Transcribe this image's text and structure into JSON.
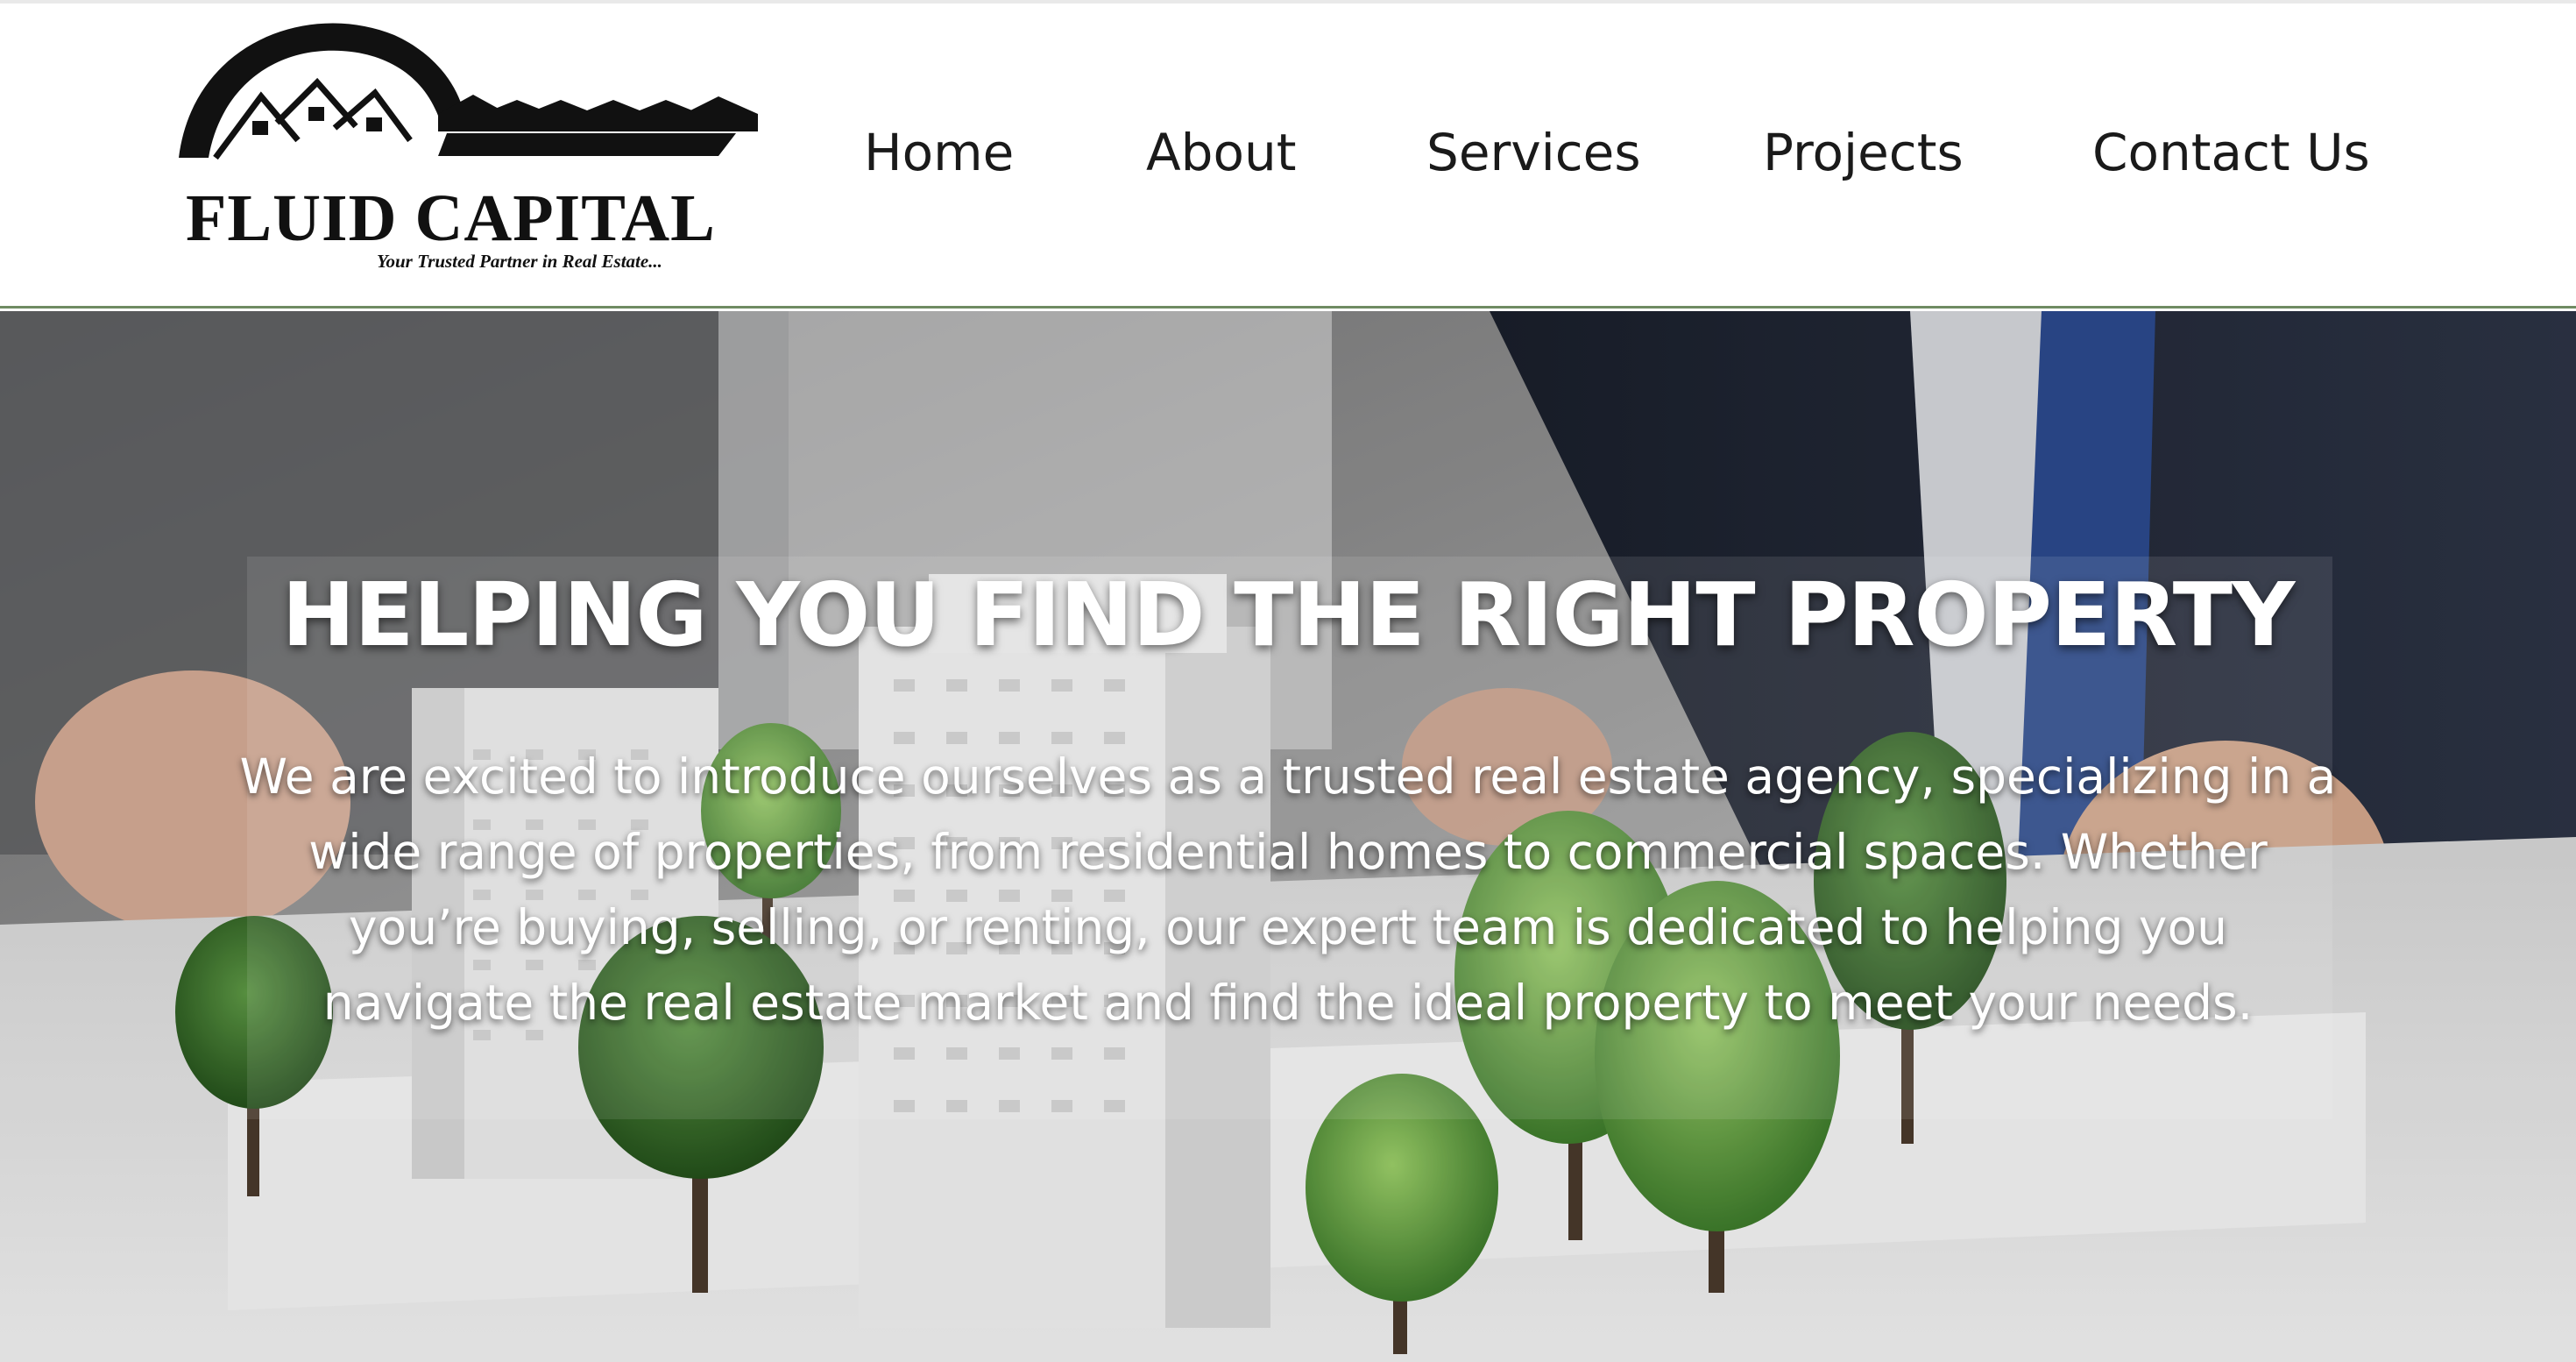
{
  "logo": {
    "name": "FLUID CAPITAL",
    "tagline": "Your Trusted Partner in Real Estate...",
    "icon": "house-roof-key-icon"
  },
  "nav": {
    "items": [
      {
        "label": "Home"
      },
      {
        "label": "About"
      },
      {
        "label": "Services"
      },
      {
        "label": "Projects"
      },
      {
        "label": "Contact Us"
      }
    ]
  },
  "hero": {
    "title": "HELPING YOU FIND THE RIGHT PROPERTY",
    "text": "We are excited to introduce ourselves as a trusted real estate agency, specializing in a wide range of properties, from residential homes to commercial spaces. Whether you’re buying, selling, or renting, our expert team is dedicated to helping you navigate the real estate market and find the ideal property to meet your needs.",
    "background": "architectural-model-photo"
  },
  "colors": {
    "header_bg": "#ffffff",
    "header_border": "#6f8b62",
    "nav_text": "#1a1a1a",
    "hero_text": "#ffffff"
  }
}
